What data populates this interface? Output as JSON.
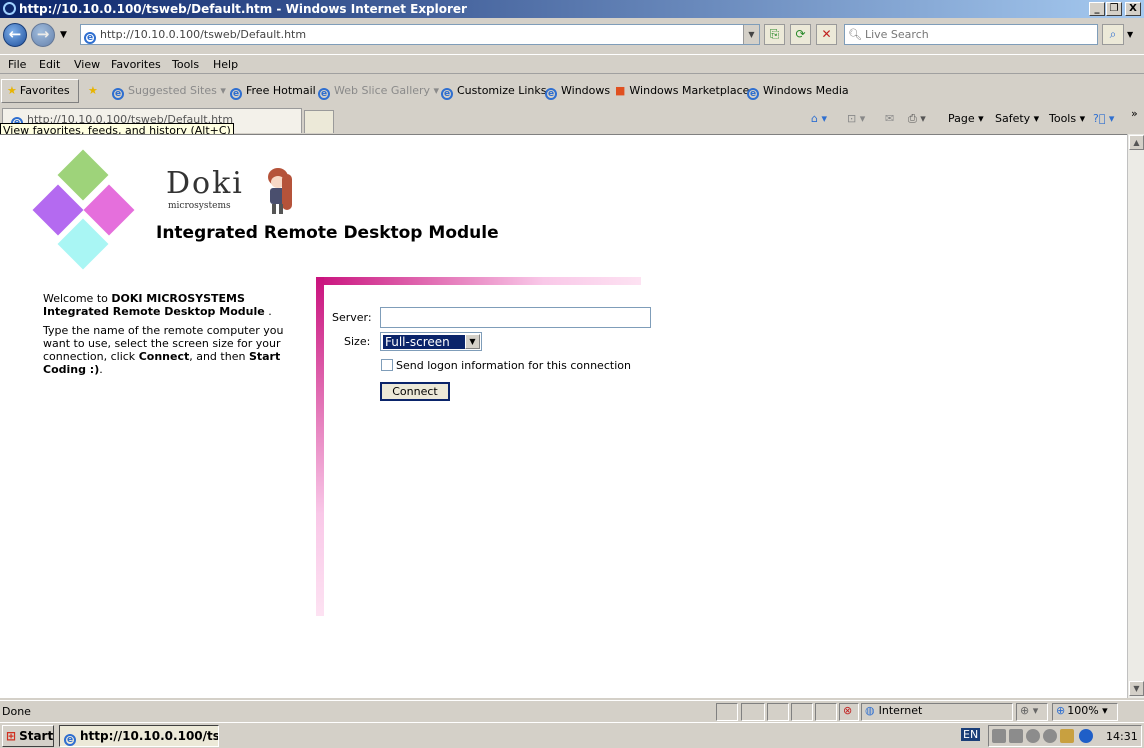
{
  "window": {
    "title": "http://10.10.0.100/tsweb/Default.htm - Windows Internet Explorer",
    "controls": {
      "minimize": "_",
      "maximize": "❐",
      "close": "X"
    }
  },
  "address_bar": {
    "url": "http://10.10.0.100/tsweb/Default.htm"
  },
  "search": {
    "placeholder": "Live Search"
  },
  "menu": [
    "File",
    "Edit",
    "View",
    "Favorites",
    "Tools",
    "Help"
  ],
  "favorites_bar": {
    "favorites_label": "Favorites",
    "items": [
      "Suggested Sites",
      "Free Hotmail",
      "Web Slice Gallery",
      "Customize Links",
      "Windows",
      "Windows Marketplace",
      "Windows Media"
    ]
  },
  "tab": {
    "label": "http://10.10.0.100/tsweb/Default.htm"
  },
  "tooltip": "View favorites, feeds, and history (Alt+C)",
  "command_bar": {
    "page": "Page",
    "safety": "Safety",
    "tools": "Tools"
  },
  "page": {
    "logo_text": "Doki",
    "logo_sub": "microsystems",
    "title": "Integrated Remote Desktop Module",
    "welcome_prefix": "Welcome to ",
    "welcome_bold": "DOKI MICROSYSTEMS Integrated Remote Desktop Module",
    "welcome_suffix": " .",
    "instr_1": "Type the name of the remote computer you want to use, select the screen size for your connection, click ",
    "instr_connect": "Connect",
    "instr_2": ", and then ",
    "instr_start": "Start Coding :)",
    "instr_3": ".",
    "form": {
      "server_label": "Server:",
      "server_value": "",
      "size_label": "Size:",
      "size_value": "Full-screen",
      "logon_label": "Send logon information for this connection",
      "connect_label": "Connect"
    }
  },
  "status_bar": {
    "status": "Done",
    "zone": "Internet",
    "zoom": "100%"
  },
  "taskbar": {
    "start": "Start",
    "task": "http://10.10.0.100/ts...",
    "lang": "EN",
    "clock": "14:31"
  },
  "colors": {
    "accent": "#c9127d",
    "pink_light": "#f9c8e8",
    "diamond_green": "#9ed37a",
    "diamond_purple": "#b46af0",
    "diamond_pink": "#e56fdc",
    "diamond_cyan": "#a9f6f4"
  }
}
